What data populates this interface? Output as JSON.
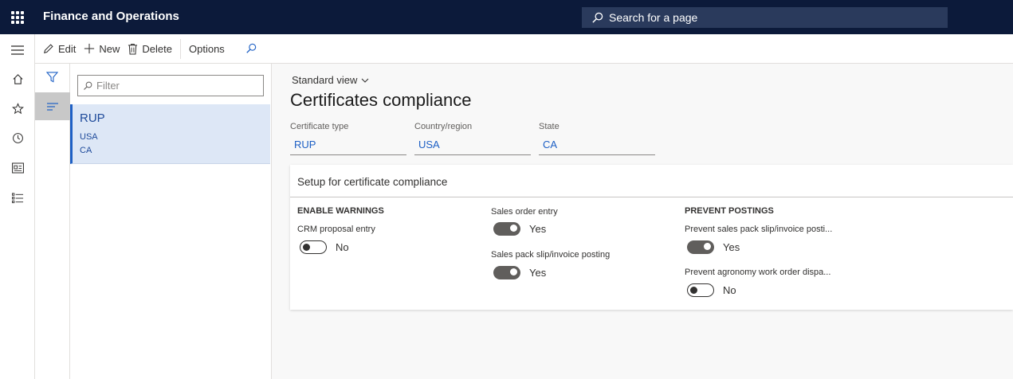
{
  "topbar": {
    "app_title": "Finance and Operations",
    "search_placeholder": "Search for a page"
  },
  "actions": {
    "edit": "Edit",
    "new": "New",
    "delete": "Delete",
    "options": "Options"
  },
  "listpane": {
    "filter_placeholder": "Filter",
    "items": [
      {
        "title": "RUP",
        "line1": "USA",
        "line2": "CA"
      }
    ]
  },
  "main": {
    "view_selector": "Standard view",
    "page_title": "Certificates compliance",
    "fields": {
      "certificate_type": {
        "label": "Certificate type",
        "value": "RUP"
      },
      "country_region": {
        "label": "Country/region",
        "value": "USA"
      },
      "state": {
        "label": "State",
        "value": "CA"
      }
    },
    "card": {
      "title": "Setup for certificate compliance",
      "enable_warnings": {
        "heading": "ENABLE WARNINGS",
        "crm_proposal_entry": {
          "label": "CRM proposal entry",
          "value": "No",
          "on": false
        },
        "sales_order_entry": {
          "label": "Sales order entry",
          "value": "Yes",
          "on": true
        },
        "sales_pack_slip": {
          "label": "Sales pack slip/invoice posting",
          "value": "Yes",
          "on": true
        }
      },
      "prevent_postings": {
        "heading": "PREVENT POSTINGS",
        "prevent_sales_pack_slip": {
          "label": "Prevent sales pack slip/invoice posti...",
          "value": "Yes",
          "on": true
        },
        "prevent_agronomy": {
          "label": "Prevent agronomy work order dispa...",
          "value": "No",
          "on": false
        }
      }
    }
  },
  "colors": {
    "topbar_bg": "#0c1a3a",
    "accent": "#1e60c5",
    "selected_row_bg": "#dde7f6"
  }
}
